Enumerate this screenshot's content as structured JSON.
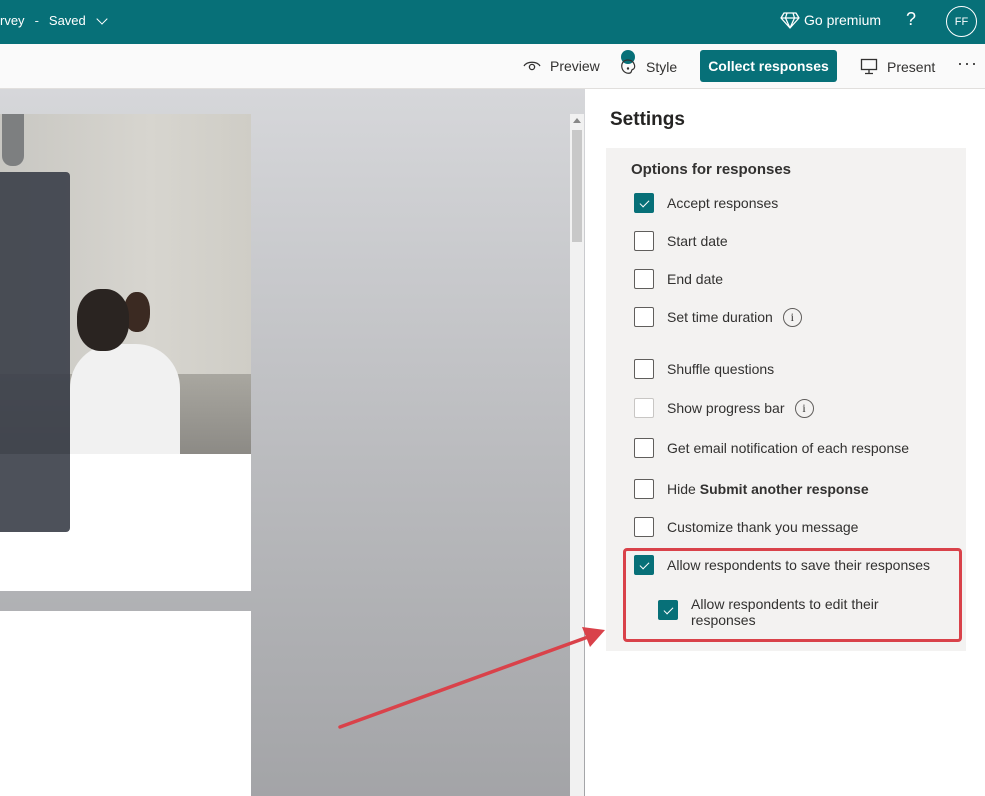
{
  "topbar": {
    "title_fragment": "rvey",
    "separator": "-",
    "save_status": "Saved",
    "premium_label": "Go premium",
    "help_label": "?",
    "avatar_initials": "FF"
  },
  "commandbar": {
    "preview_label": "Preview",
    "style_label": "Style",
    "collect_label": "Collect responses",
    "present_label": "Present",
    "more_label": "···"
  },
  "settings": {
    "title": "Settings",
    "options_heading": "Options for responses",
    "options": [
      {
        "label": "Accept responses",
        "checked": true
      },
      {
        "label": "Start date",
        "checked": false
      },
      {
        "label": "End date",
        "checked": false
      },
      {
        "label": "Set time duration",
        "checked": false,
        "info": true
      },
      {
        "label": "Shuffle questions",
        "checked": false
      },
      {
        "label": "Show progress bar",
        "checked": false,
        "info": true,
        "disabled": true
      },
      {
        "label": "Get email notification of each response",
        "checked": false
      },
      {
        "label_prefix": "Hide",
        "label_bold": "Submit another response",
        "checked": false
      },
      {
        "label": "Customize thank you message",
        "checked": false
      },
      {
        "label": "Allow respondents to save their responses",
        "checked": true
      }
    ],
    "sub_option": {
      "label": "Allow respondents to edit their responses",
      "checked": true
    },
    "info_glyph": "i"
  },
  "colors": {
    "brand": "#077078",
    "highlight": "#d9424a"
  }
}
